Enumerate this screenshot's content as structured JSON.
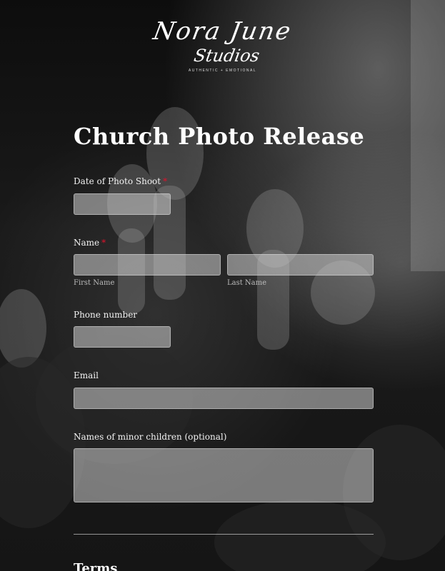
{
  "brand": {
    "logo_line1": "Nora June",
    "logo_line2": "Studios",
    "tagline": "AUTHENTIC + EMOTIONAL"
  },
  "form": {
    "title": "Church Photo Release",
    "date": {
      "label": "Date of Photo Shoot",
      "required": "*",
      "value": ""
    },
    "name": {
      "label": "Name",
      "required": "*",
      "first_label": "First Name",
      "last_label": "Last Name",
      "first_value": "",
      "last_value": ""
    },
    "phone": {
      "label": "Phone number",
      "value": ""
    },
    "email": {
      "label": "Email",
      "value": ""
    },
    "children": {
      "label": "Names of minor children (optional)",
      "value": ""
    },
    "terms": {
      "label": "Terms"
    }
  },
  "colors": {
    "required_marker": "#e0122c",
    "field_bg": "rgba(205,205,205,0.55)"
  }
}
